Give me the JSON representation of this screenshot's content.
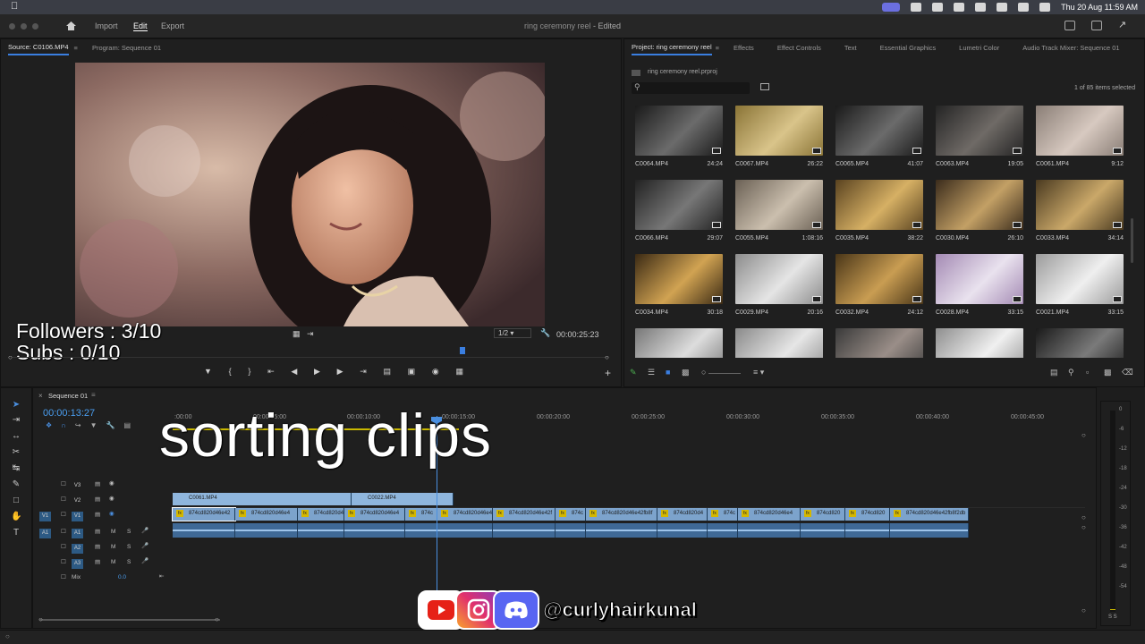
{
  "menubar": {
    "clock": "Thu 20 Aug  11:59 AM"
  },
  "header": {
    "workspaces": [
      "Import",
      "Edit",
      "Export"
    ],
    "active_workspace": "Edit",
    "doc_title": "ring ceremony reel",
    "doc_status": " - Edited"
  },
  "source": {
    "tabs": [
      "Source: C0106.MP4",
      "Program: Sequence 01"
    ],
    "scale": "1/2",
    "duration": "00:00:25:23"
  },
  "project": {
    "tabs": [
      "Project: ring ceremony reel",
      "Effects",
      "Effect Controls",
      "Text",
      "Essential Graphics",
      "Lumetri Color",
      "Audio Track Mixer: Sequence 01"
    ],
    "file": "ring ceremony reel.prproj",
    "selection": "1 of 85 items selected",
    "items": [
      {
        "name": "C0064.MP4",
        "dur": "24:24",
        "c1": "#1a1a1a",
        "c2": "#6b6b6b"
      },
      {
        "name": "C0067.MP4",
        "dur": "26:22",
        "c1": "#8a7436",
        "c2": "#d9c48a"
      },
      {
        "name": "C0065.MP4",
        "dur": "41:07",
        "c1": "#1a1a1a",
        "c2": "#6b6b6b"
      },
      {
        "name": "C0063.MP4",
        "dur": "19:05",
        "c1": "#242424",
        "c2": "#6f6a66"
      },
      {
        "name": "C0061.MP4",
        "dur": "9:12",
        "c1": "#8a7e76",
        "c2": "#d7c9c0"
      },
      {
        "name": "C0066.MP4",
        "dur": "29:07",
        "c1": "#222",
        "c2": "#777"
      },
      {
        "name": "C0055.MP4",
        "dur": "1:08:16",
        "c1": "#6b6155",
        "c2": "#cbbfae"
      },
      {
        "name": "C0035.MP4",
        "dur": "38:22",
        "c1": "#5a4320",
        "c2": "#d6b064"
      },
      {
        "name": "C0030.MP4",
        "dur": "26:10",
        "c1": "#3b2c1c",
        "c2": "#c3a065"
      },
      {
        "name": "C0033.MP4",
        "dur": "34:14",
        "c1": "#4a3a20",
        "c2": "#caa869"
      },
      {
        "name": "C0034.MP4",
        "dur": "30:18",
        "c1": "#3b2a14",
        "c2": "#d1a352"
      },
      {
        "name": "C0029.MP4",
        "dur": "20:16",
        "c1": "#8c8c8c",
        "c2": "#e5e5e5"
      },
      {
        "name": "C0032.MP4",
        "dur": "24:12",
        "c1": "#4a3618",
        "c2": "#c99d52"
      },
      {
        "name": "C0028.MP4",
        "dur": "33:15",
        "c1": "#a48ab4",
        "c2": "#e9e2ee"
      },
      {
        "name": "C0021.MP4",
        "dur": "33:15",
        "c1": "#9b9b9b",
        "c2": "#efefef"
      },
      {
        "name": "",
        "dur": "",
        "c1": "#777",
        "c2": "#ddd"
      },
      {
        "name": "",
        "dur": "",
        "c1": "#8a8a8a",
        "c2": "#e6e6e6"
      },
      {
        "name": "",
        "dur": "",
        "c1": "#3a3a3a",
        "c2": "#9a8e88"
      },
      {
        "name": "",
        "dur": "",
        "c1": "#8e8e8e",
        "c2": "#f0f0f0"
      },
      {
        "name": "",
        "dur": "",
        "c1": "#1a1a1a",
        "c2": "#7a7a7a"
      }
    ]
  },
  "timeline": {
    "tab": "Sequence 01",
    "timecode": "00:00:13:27",
    "ruler": [
      ":00:00",
      "00:00:05:00",
      "00:00:10:00",
      "00:00:15:00",
      "00:00:20:00",
      "00:00:25:00",
      "00:00:30:00",
      "00:00:35:00",
      "00:00:40:00",
      "00:00:45:00"
    ],
    "tracks": {
      "v3": "V3",
      "v2": "V2",
      "v1": "V1",
      "v1src": "V1",
      "a1": "A1",
      "a1src": "A1",
      "a2": "A2",
      "a3": "A3",
      "mix": "Mix",
      "mix_val": "0.0"
    },
    "v2_clips": [
      "C0061.MP4",
      "C0022.MP4"
    ],
    "v1_clip_label": "874cd820d46e42fb8f2db",
    "v1_clips": [
      "874cd820d46e42",
      "874cd820d46e4",
      "874cd820d4",
      "874cd820d46e4",
      "874c",
      "874cd820d46e4",
      "874cd820d46e42f",
      "874c",
      "874cd820d46e42fb8f",
      "874cd820d4",
      "874c",
      "874cd820d46e4",
      "874cd820",
      "874cd820",
      "874cd820d46e42fb8f2db"
    ],
    "meter_scale": [
      "0",
      "-6",
      "-12",
      "-18",
      "-24",
      "-30",
      "-36",
      "-42",
      "-48",
      "-54"
    ],
    "meter_solo": "S S"
  },
  "overlay": {
    "followers": "Followers : 3/10",
    "subs": "Subs : 0/10",
    "caption": "sorting clips",
    "handle": "@curlyhairkunal"
  },
  "colors": {
    "accent": "#3a7ee0",
    "v_clip": "#8fb6dd",
    "a_clip": "#3f6996"
  }
}
